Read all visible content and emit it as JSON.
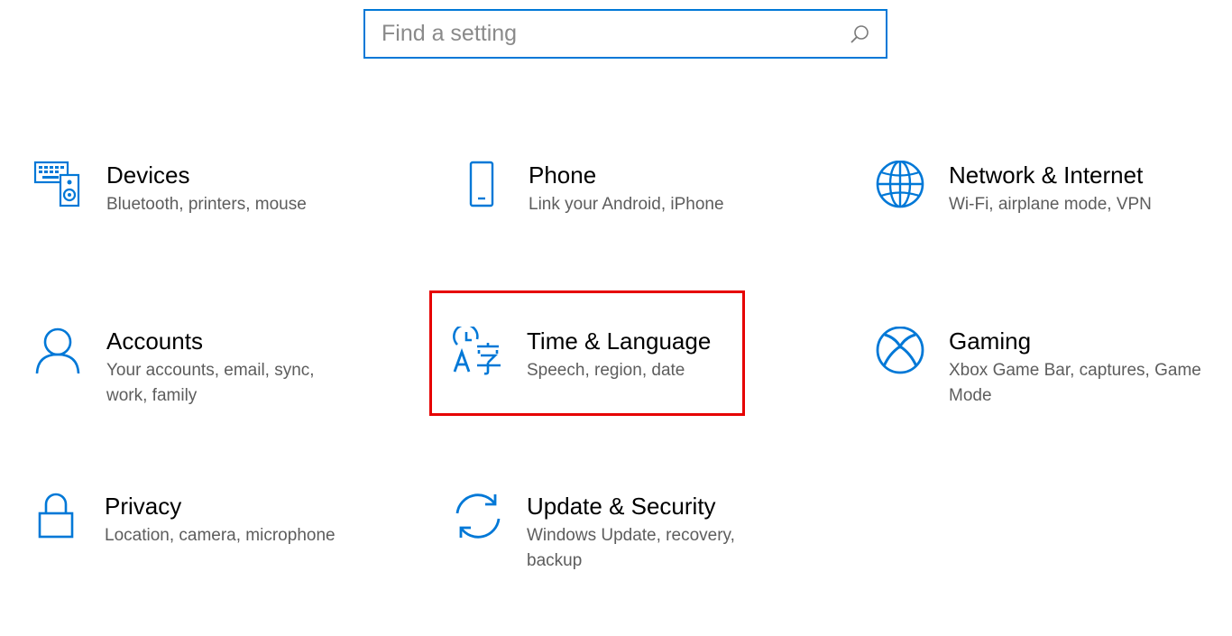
{
  "search": {
    "placeholder": "Find a setting",
    "value": "",
    "icon": "search-icon"
  },
  "accent_color": "#0078d7",
  "highlight_color": "#e60000",
  "tiles": [
    {
      "title": "Devices",
      "desc": "Bluetooth, printers, mouse",
      "icon": "devices-icon"
    },
    {
      "title": "Phone",
      "desc": "Link your Android, iPhone",
      "icon": "phone-icon"
    },
    {
      "title": "Network & Internet",
      "desc": "Wi-Fi, airplane mode, VPN",
      "icon": "globe-icon"
    },
    {
      "title": "Accounts",
      "desc": "Your accounts, email, sync, work, family",
      "icon": "person-icon"
    },
    {
      "title": "Time & Language",
      "desc": "Speech, region, date",
      "icon": "time-language-icon"
    },
    {
      "title": "Gaming",
      "desc": "Xbox Game Bar, captures, Game Mode",
      "icon": "xbox-icon"
    },
    {
      "title": "Privacy",
      "desc": "Location, camera, microphone",
      "icon": "lock-icon"
    },
    {
      "title": "Update & Security",
      "desc": "Windows Update, recovery, backup",
      "icon": "sync-icon"
    }
  ]
}
